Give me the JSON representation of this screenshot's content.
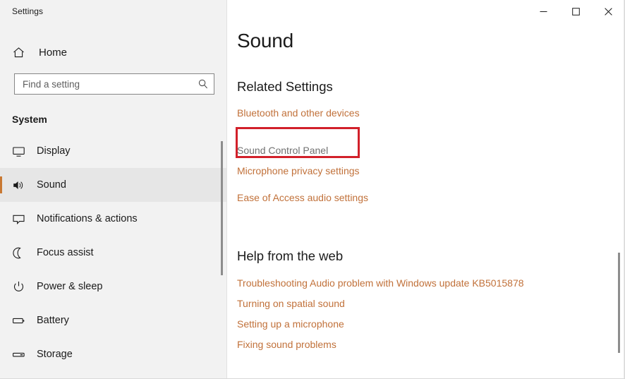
{
  "window": {
    "app_title": "Settings",
    "controls": [
      {
        "name": "minimize",
        "glyph": "─"
      },
      {
        "name": "maximize",
        "glyph": "□"
      },
      {
        "name": "close",
        "glyph": "✕"
      }
    ]
  },
  "sidebar": {
    "home_label": "Home",
    "search": {
      "placeholder": "Find a setting",
      "value": ""
    },
    "category": "System",
    "items": [
      {
        "label": "Display",
        "icon": "monitor-icon",
        "selected": false
      },
      {
        "label": "Sound",
        "icon": "speaker-icon",
        "selected": true
      },
      {
        "label": "Notifications & actions",
        "icon": "speech-bubble-icon",
        "selected": false
      },
      {
        "label": "Focus assist",
        "icon": "moon-icon",
        "selected": false
      },
      {
        "label": "Power & sleep",
        "icon": "power-icon",
        "selected": false
      },
      {
        "label": "Battery",
        "icon": "battery-icon",
        "selected": false
      },
      {
        "label": "Storage",
        "icon": "storage-icon",
        "selected": false
      }
    ]
  },
  "main": {
    "page_title": "Sound",
    "related": {
      "heading": "Related Settings",
      "links": [
        {
          "label": "Bluetooth and other devices",
          "style": "link",
          "highlighted": false
        },
        {
          "label": "Sound Control Panel",
          "style": "muted",
          "highlighted": true
        },
        {
          "label": "Microphone privacy settings",
          "style": "link",
          "highlighted": false
        },
        {
          "label": "Ease of Access audio settings",
          "style": "link",
          "highlighted": false
        }
      ]
    },
    "help": {
      "heading": "Help from the web",
      "links": [
        {
          "label": "Troubleshooting Audio problem with Windows update KB5015878"
        },
        {
          "label": "Turning on spatial sound"
        },
        {
          "label": "Setting up a microphone"
        },
        {
          "label": "Fixing sound problems"
        }
      ]
    }
  },
  "colors": {
    "link": "#c1713a",
    "accent_selected": "#c87832",
    "annotation": "#d2202a",
    "sidebar_bg": "#f2f2f2",
    "text": "#1b1b1b"
  }
}
